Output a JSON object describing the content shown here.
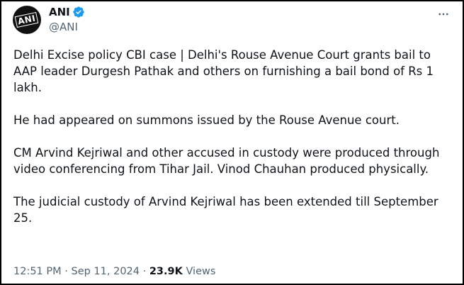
{
  "tweet": {
    "display_name": "ANI",
    "handle": "@ANI",
    "avatar_text": "ANI",
    "verified": true,
    "paragraphs": [
      "Delhi Excise policy CBI case | Delhi's Rouse Avenue Court grants bail to AAP leader Durgesh Pathak and others on furnishing a bail bond of Rs 1 lakh.",
      "He had appeared on summons issued by the Rouse Avenue court.",
      "CM Arvind Kejriwal and other accused in custody were produced through video conferencing from Tihar Jail. Vinod Chauhan produced physically.",
      "The judicial custody of Arvind Kejriwal has been extended till September 25."
    ],
    "time": "12:51 PM",
    "separator": "·",
    "date": "Sep 11, 2024",
    "views_count": "23.9K",
    "views_label": "Views"
  },
  "icons": {
    "verified": "verified-badge-icon",
    "more": "more-options-icon"
  },
  "colors": {
    "text": "#0f1419",
    "secondary": "#536471",
    "verified_blue": "#1d9bf0",
    "border": "#000000"
  }
}
